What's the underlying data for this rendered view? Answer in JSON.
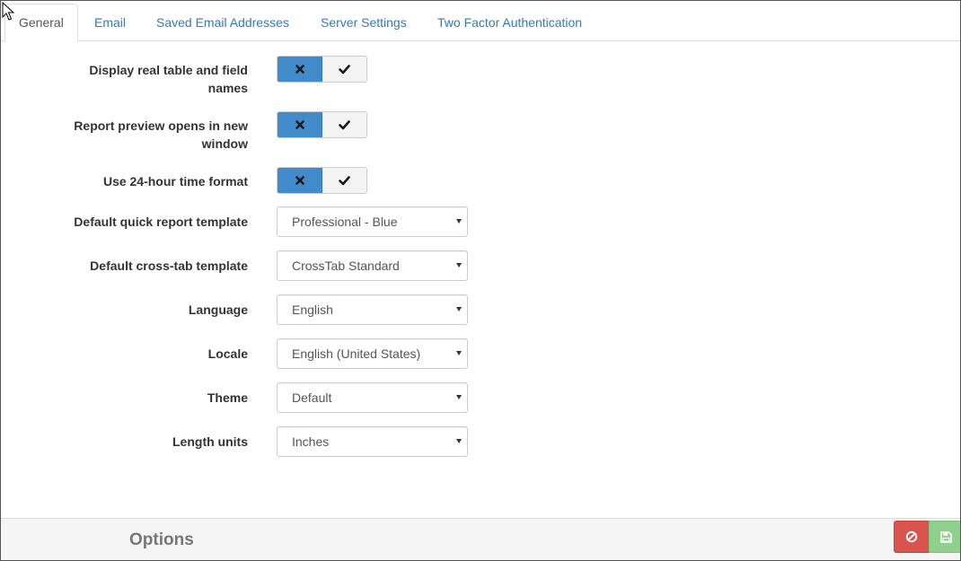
{
  "tabs": [
    {
      "label": "General",
      "active": true
    },
    {
      "label": "Email"
    },
    {
      "label": "Saved Email Addresses"
    },
    {
      "label": "Server Settings"
    },
    {
      "label": "Two Factor Authentication"
    }
  ],
  "toggles": [
    {
      "label_line1": "Display real table and field",
      "label_line2": "names",
      "value": false
    },
    {
      "label_line1": "Report preview opens in new",
      "label_line2": "window",
      "value": false
    },
    {
      "label_line1": "Use 24-hour time format",
      "value": false
    }
  ],
  "selects": [
    {
      "label": "Default quick report template",
      "value": "Professional - Blue"
    },
    {
      "label": "Default cross-tab template",
      "value": "CrossTab Standard"
    },
    {
      "label": "Language",
      "value": "English"
    },
    {
      "label": "Locale",
      "value": "English (United States)"
    },
    {
      "label": "Theme",
      "value": "Default"
    },
    {
      "label": "Length units",
      "value": "Inches"
    }
  ],
  "footer": {
    "title": "Options"
  },
  "icons": {
    "toggle_off": "x-icon",
    "toggle_on": "check-icon",
    "cancel": "ban-icon",
    "save": "floppy-disk-icon"
  },
  "colors": {
    "accent": "#428bca",
    "link": "#337ab7",
    "danger": "#d9534f",
    "success": "#8fd08f"
  }
}
